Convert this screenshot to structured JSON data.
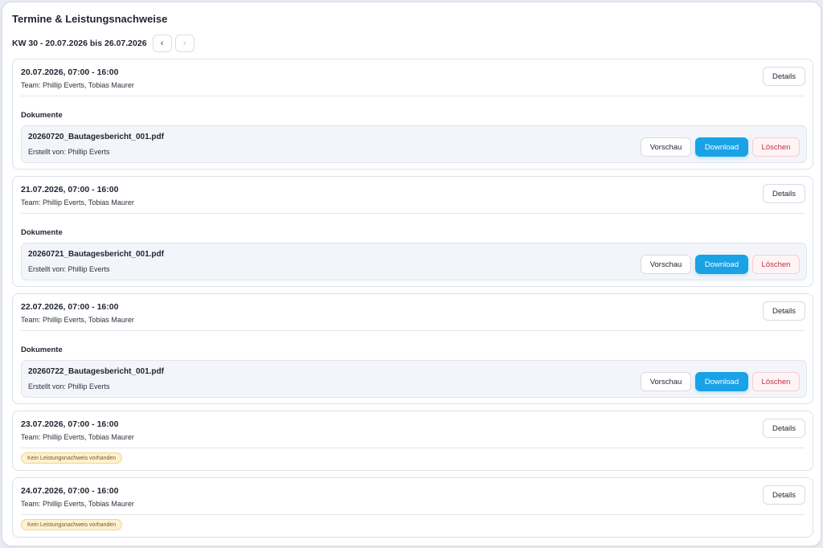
{
  "page": {
    "title": "Termine & Leistungsnachweise",
    "week_label": "KW 30 - 20.07.2026 bis 26.07.2026",
    "prev_icon": "‹",
    "next_icon": "›"
  },
  "labels": {
    "details": "Details",
    "documents": "Dokumente",
    "preview": "Vorschau",
    "download": "Download",
    "delete": "Löschen",
    "no_proof": "Kein Leistungsnachweis vorhanden"
  },
  "colors": {
    "accent": "#19a2e6",
    "danger": "#c13040",
    "warning_bg": "#fdf1d4"
  },
  "appointments": [
    {
      "datetime": "20.07.2026, 07:00 - 16:00",
      "team": "Team: Phillip Everts, Tobias Maurer",
      "document": {
        "name": "20260720_Bautagesbericht_001.pdf",
        "author": "Erstellt von: Phillip Everts"
      }
    },
    {
      "datetime": "21.07.2026, 07:00 - 16:00",
      "team": "Team: Phillip Everts, Tobias Maurer",
      "document": {
        "name": "20260721_Bautagesbericht_001.pdf",
        "author": "Erstellt von: Phillip Everts"
      }
    },
    {
      "datetime": "22.07.2026, 07:00 - 16:00",
      "team": "Team: Phillip Everts, Tobias Maurer",
      "document": {
        "name": "20260722_Bautagesbericht_001.pdf",
        "author": "Erstellt von: Phillip Everts"
      }
    },
    {
      "datetime": "23.07.2026, 07:00 - 16:00",
      "team": "Team: Phillip Everts, Tobias Maurer",
      "document": null
    },
    {
      "datetime": "24.07.2026, 07:00 - 16:00",
      "team": "Team: Phillip Everts, Tobias Maurer",
      "document": null
    }
  ]
}
